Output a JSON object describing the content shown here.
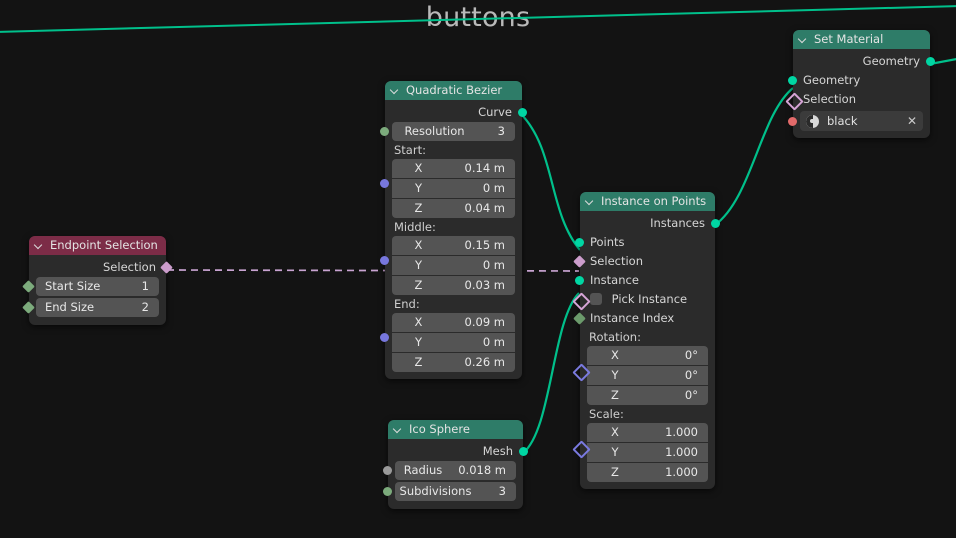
{
  "editor": {
    "title": "buttons",
    "background_color": "#131313"
  },
  "colors": {
    "header_geometry": "#2e7c68",
    "header_attribute": "#7c2c47",
    "node_body": "#2b2b2b",
    "widget": "#545454",
    "wire_geometry": "#00c08b",
    "wire_field_bool": "#c9a4d2"
  },
  "nodes": {
    "endpoint_selection": {
      "title": "Endpoint Selection",
      "collapse_icon": "chevron-down-icon",
      "outputs": [
        {
          "label": "Selection",
          "socket": "field-boolean"
        }
      ],
      "fields": [
        {
          "name": "Start Size",
          "value": "1",
          "socket": "field-int"
        },
        {
          "name": "End Size",
          "value": "2",
          "socket": "field-int"
        }
      ]
    },
    "quadratic_bezier": {
      "title": "Quadratic Bezier",
      "collapse_icon": "chevron-down-icon",
      "outputs": [
        {
          "label": "Curve",
          "socket": "geometry"
        }
      ],
      "resolution": {
        "name": "Resolution",
        "value": "3",
        "socket": "field-int"
      },
      "groups": [
        {
          "label": "Start:",
          "socket": "vector",
          "rows": [
            {
              "axis": "X",
              "value": "0.14 m"
            },
            {
              "axis": "Y",
              "value": "0 m"
            },
            {
              "axis": "Z",
              "value": "0.04 m"
            }
          ]
        },
        {
          "label": "Middle:",
          "socket": "vector",
          "rows": [
            {
              "axis": "X",
              "value": "0.15 m"
            },
            {
              "axis": "Y",
              "value": "0 m"
            },
            {
              "axis": "Z",
              "value": "0.03 m"
            }
          ]
        },
        {
          "label": "End:",
          "socket": "vector",
          "rows": [
            {
              "axis": "X",
              "value": "0.09 m"
            },
            {
              "axis": "Y",
              "value": "0 m"
            },
            {
              "axis": "Z",
              "value": "0.26 m"
            }
          ]
        }
      ]
    },
    "ico_sphere": {
      "title": "Ico Sphere",
      "collapse_icon": "chevron-down-icon",
      "outputs": [
        {
          "label": "Mesh",
          "socket": "geometry"
        }
      ],
      "fields": [
        {
          "name": "Radius",
          "value": "0.018 m",
          "socket": "float"
        },
        {
          "name": "Subdivisions",
          "value": "3",
          "socket": "int"
        }
      ]
    },
    "instance_on_points": {
      "title": "Instance on Points",
      "collapse_icon": "chevron-down-icon",
      "outputs": [
        {
          "label": "Instances",
          "socket": "geometry"
        }
      ],
      "inputs": [
        {
          "label": "Points",
          "socket": "geometry"
        },
        {
          "label": "Selection",
          "socket": "field-boolean"
        },
        {
          "label": "Instance",
          "socket": "geometry"
        },
        {
          "label": "Pick Instance",
          "socket": "field-boolean",
          "checkbox": false
        },
        {
          "label": "Instance Index",
          "socket": "field-int"
        }
      ],
      "groups": [
        {
          "label": "Rotation:",
          "socket": "vector",
          "rows": [
            {
              "axis": "X",
              "value": "0°"
            },
            {
              "axis": "Y",
              "value": "0°"
            },
            {
              "axis": "Z",
              "value": "0°"
            }
          ]
        },
        {
          "label": "Scale:",
          "socket": "vector",
          "rows": [
            {
              "axis": "X",
              "value": "1.000"
            },
            {
              "axis": "Y",
              "value": "1.000"
            },
            {
              "axis": "Z",
              "value": "1.000"
            }
          ]
        }
      ]
    },
    "set_material": {
      "title": "Set Material",
      "collapse_icon": "chevron-down-icon",
      "outputs": [
        {
          "label": "Geometry",
          "socket": "geometry"
        }
      ],
      "inputs": [
        {
          "label": "Geometry",
          "socket": "geometry"
        },
        {
          "label": "Selection",
          "socket": "field-boolean"
        }
      ],
      "material": {
        "icon": "material-sphere-icon",
        "name": "black",
        "clear_icon": "close-icon"
      }
    }
  },
  "links": [
    {
      "from": "endpoint_selection.Selection",
      "to": "instance_on_points.Selection",
      "style": "dashed",
      "color": "#c9a4d2"
    },
    {
      "from": "quadratic_bezier.Curve",
      "to": "instance_on_points.Points",
      "style": "solid",
      "color": "#00c08b"
    },
    {
      "from": "ico_sphere.Mesh",
      "to": "instance_on_points.Instance",
      "style": "solid",
      "color": "#00c08b"
    },
    {
      "from": "instance_on_points.Instances",
      "to": "set_material.Geometry",
      "style": "solid",
      "color": "#00c08b"
    },
    {
      "from": "set_material.Geometry",
      "to": "offscreen-right",
      "style": "solid",
      "color": "#00c08b"
    },
    {
      "from": "offscreen-left",
      "to": "offscreen-top-right",
      "style": "solid",
      "color": "#00c08b"
    }
  ]
}
